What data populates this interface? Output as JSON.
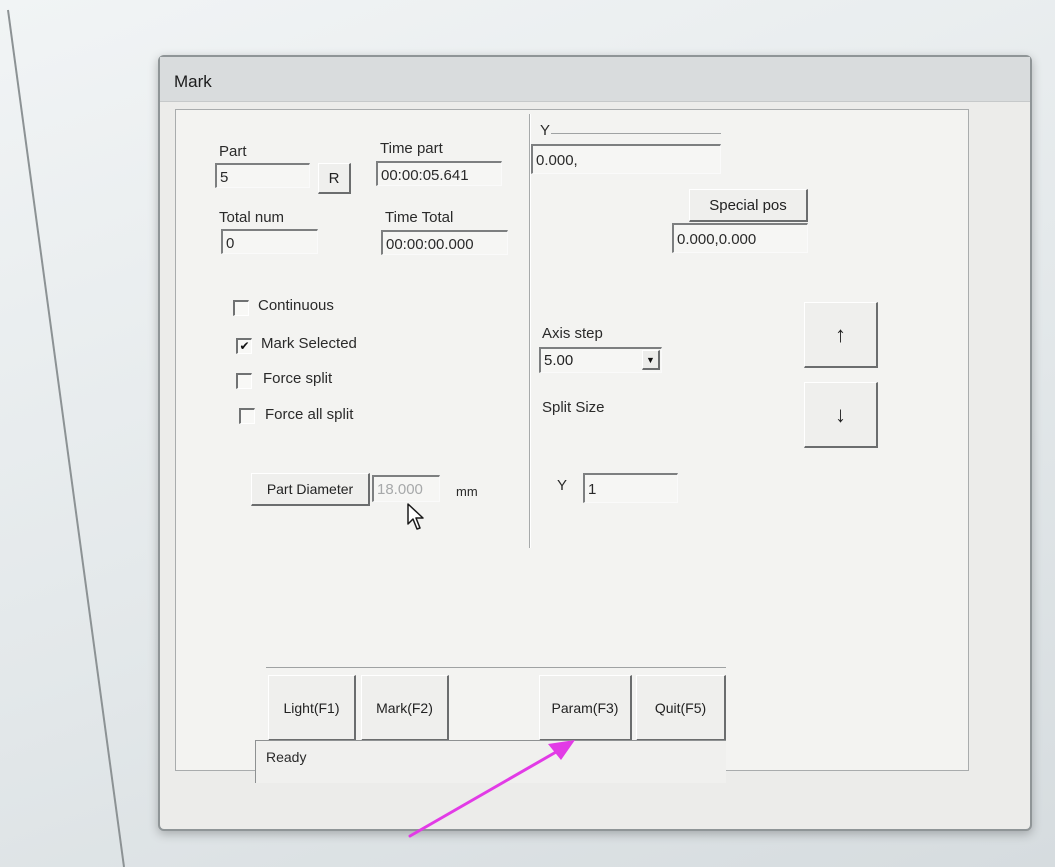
{
  "window": {
    "title": "Mark"
  },
  "part": {
    "label": "Part",
    "value": "5",
    "reset_label": "R"
  },
  "time_part": {
    "label": "Time part",
    "value": "00:00:05.641"
  },
  "total_num": {
    "label": "Total num",
    "value": "0"
  },
  "time_total": {
    "label": "Time Total",
    "value": "00:00:00.000"
  },
  "options": [
    {
      "label": "Continuous",
      "checked": false
    },
    {
      "label": "Mark Selected",
      "checked": true
    },
    {
      "label": "Force split",
      "checked": false
    },
    {
      "label": "Force all split",
      "checked": false
    }
  ],
  "part_diameter": {
    "button_label": "Part Diameter",
    "value": "18.000",
    "unit": "mm"
  },
  "y_position": {
    "label": "Y",
    "value": "0.000,"
  },
  "special_pos": {
    "button_label": "Special pos",
    "value": "0.000,0.000"
  },
  "axis_step": {
    "label": "Axis step",
    "value": "5.00"
  },
  "split_size": {
    "label": "Split Size",
    "y_label": "Y",
    "y_value": "1"
  },
  "arrows": {
    "up": "↑",
    "down": "↓"
  },
  "buttons": {
    "light": "Light(F1)",
    "mark": "Mark(F2)",
    "param": "Param(F3)",
    "quit": "Quit(F5)"
  },
  "status": {
    "text": "Ready"
  },
  "colors": {
    "annotation_arrow": "#e23be6"
  },
  "icons": {
    "cursor": "mouse-pointer-icon",
    "check": "checkmark-icon",
    "dropdown": "dropdown-arrow-icon"
  }
}
